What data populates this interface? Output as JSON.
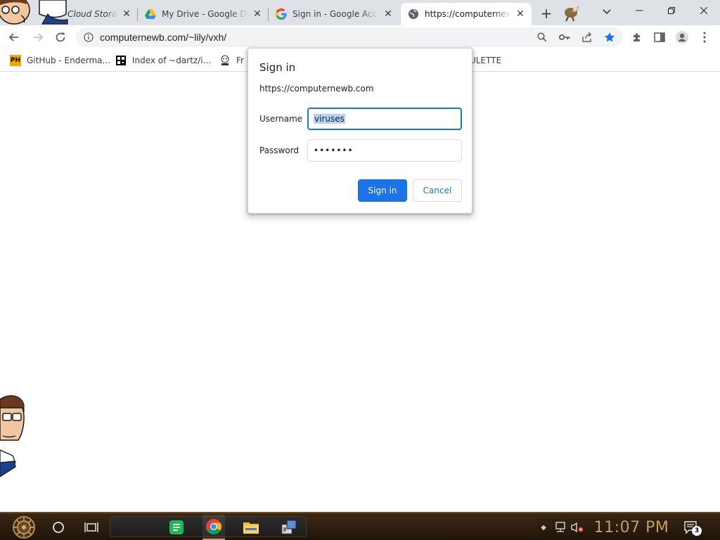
{
  "tabs": [
    {
      "title": "Cloud Storage",
      "icon": "cloud-storage-icon"
    },
    {
      "title": "My Drive - Google Drive",
      "icon": "google-drive-icon"
    },
    {
      "title": "Sign in - Google Accounts",
      "icon": "google-g-icon"
    },
    {
      "title": "https://computernewb.com",
      "icon": "globe-icon",
      "active": true
    }
  ],
  "toolbar": {
    "url": "computernewb.com/~lily/vxh/"
  },
  "bookmarks": [
    {
      "label": "GitHub - Enderma...",
      "icon": "ph-icon"
    },
    {
      "label": "Index of ~dartz/i...",
      "icon": "qr-icon"
    },
    {
      "label": "Fr",
      "icon": "mascot-icon"
    },
    {
      "label": "ULETTE",
      "icon": ""
    }
  ],
  "dialog": {
    "title": "Sign in",
    "origin": "https://computernewb.com",
    "username_label": "Username",
    "username_value": "viruses",
    "password_label": "Password",
    "password_value": "•••••••",
    "signin_label": "Sign in",
    "cancel_label": "Cancel"
  },
  "taskbar": {
    "clock": "11:07 PM",
    "notification_count": "3"
  },
  "colors": {
    "accent": "#1a73e8",
    "tabstrip": "#dee1e6",
    "clock": "#c8a15c"
  }
}
